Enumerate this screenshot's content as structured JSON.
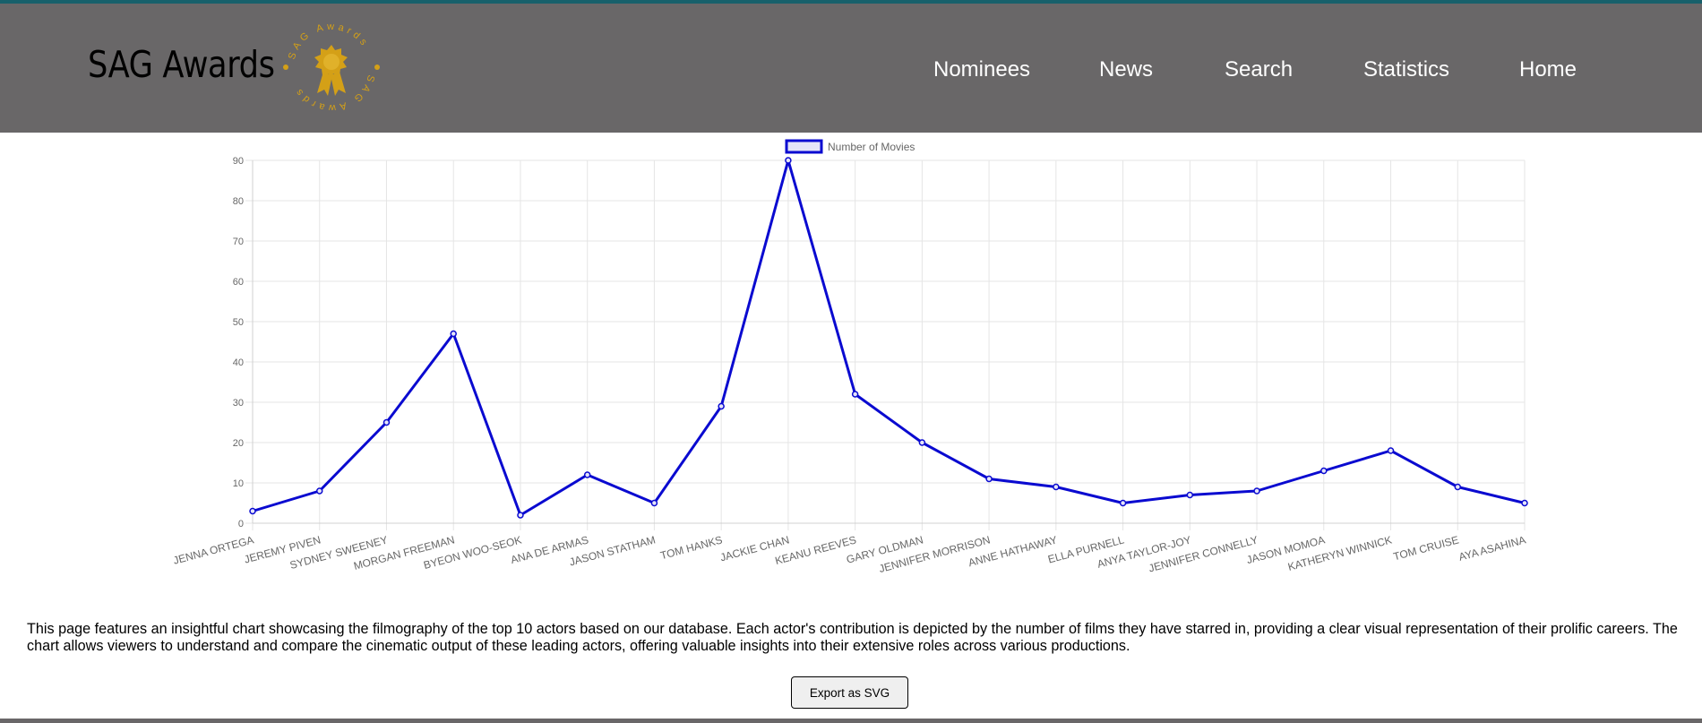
{
  "brand": {
    "title": "SAG Awards",
    "emblem_text": "SAG Awards",
    "emblem_color": "#d4a017"
  },
  "nav": {
    "items": [
      {
        "label": "Nominees"
      },
      {
        "label": "News"
      },
      {
        "label": "Search"
      },
      {
        "label": "Statistics"
      },
      {
        "label": "Home"
      }
    ]
  },
  "colors": {
    "header_bg": "#696768",
    "accent_stripe": "#17606b",
    "series_line": "#0a0ad0",
    "legend_fill": "#e4e4f8"
  },
  "chart_data": {
    "type": "line",
    "categories": [
      "JENNA ORTEGA",
      "JEREMY PIVEN",
      "SYDNEY SWEENEY",
      "MORGAN FREEMAN",
      "BYEON WOO-SEOK",
      "ANA DE ARMAS",
      "JASON STATHAM",
      "TOM HANKS",
      "JACKIE CHAN",
      "KEANU REEVES",
      "GARY OLDMAN",
      "JENNIFER MORRISON",
      "ANNE HATHAWAY",
      "ELLA PURNELL",
      "ANYA TAYLOR-JOY",
      "JENNIFER CONNELLY",
      "JASON MOMOA",
      "KATHERYN WINNICK",
      "TOM CRUISE",
      "AYA ASAHINA"
    ],
    "series": [
      {
        "name": "Number of Movies",
        "values": [
          3,
          8,
          25,
          47,
          2,
          12,
          5,
          29,
          90,
          32,
          20,
          11,
          9,
          5,
          7,
          8,
          13,
          18,
          9,
          5
        ]
      }
    ],
    "yticks": [
      "0",
      "10",
      "20",
      "30",
      "40",
      "50",
      "60",
      "70",
      "80",
      "90"
    ],
    "ylim": [
      0,
      90
    ],
    "grid": true,
    "legend_position": "top"
  },
  "description": "This page features an insightful chart showcasing the filmography of the top 10 actors based on our database. Each actor's contribution is depicted by the number of films they have starred in, providing a clear visual representation of their prolific careers. The chart allows viewers to understand and compare the cinematic output of these leading actors, offering valuable insights into their extensive roles across various productions.",
  "export_button": {
    "label": "Export as SVG"
  }
}
